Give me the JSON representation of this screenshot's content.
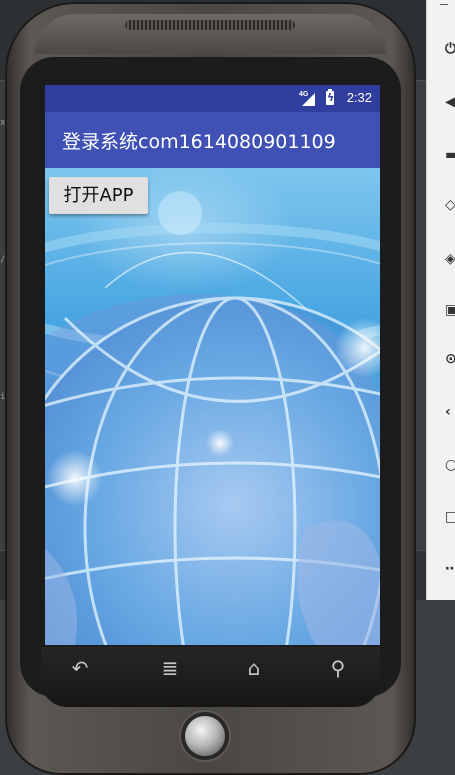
{
  "window": {
    "left_glyphs": [
      "x",
      "/",
      "i"
    ]
  },
  "toolbar": {
    "icons": [
      "power-icon",
      "volume-up-icon",
      "volume-down-icon",
      "rotate-left-icon",
      "rotate-right-icon",
      "camera-icon",
      "zoom-icon",
      "back-icon",
      "home-icon",
      "overview-icon",
      "more-icon"
    ]
  },
  "status_bar": {
    "network": "4G",
    "time": "2:32"
  },
  "app": {
    "title": "登录系统com1614080901109",
    "open_button": "打开APP"
  },
  "nav_bar": {
    "icons": [
      "back-icon",
      "menu-icon",
      "home-icon",
      "search-icon"
    ]
  },
  "colors": {
    "status_bar": "#303f9f",
    "app_bar": "#3f51b5",
    "button": "#e0e0e0"
  }
}
